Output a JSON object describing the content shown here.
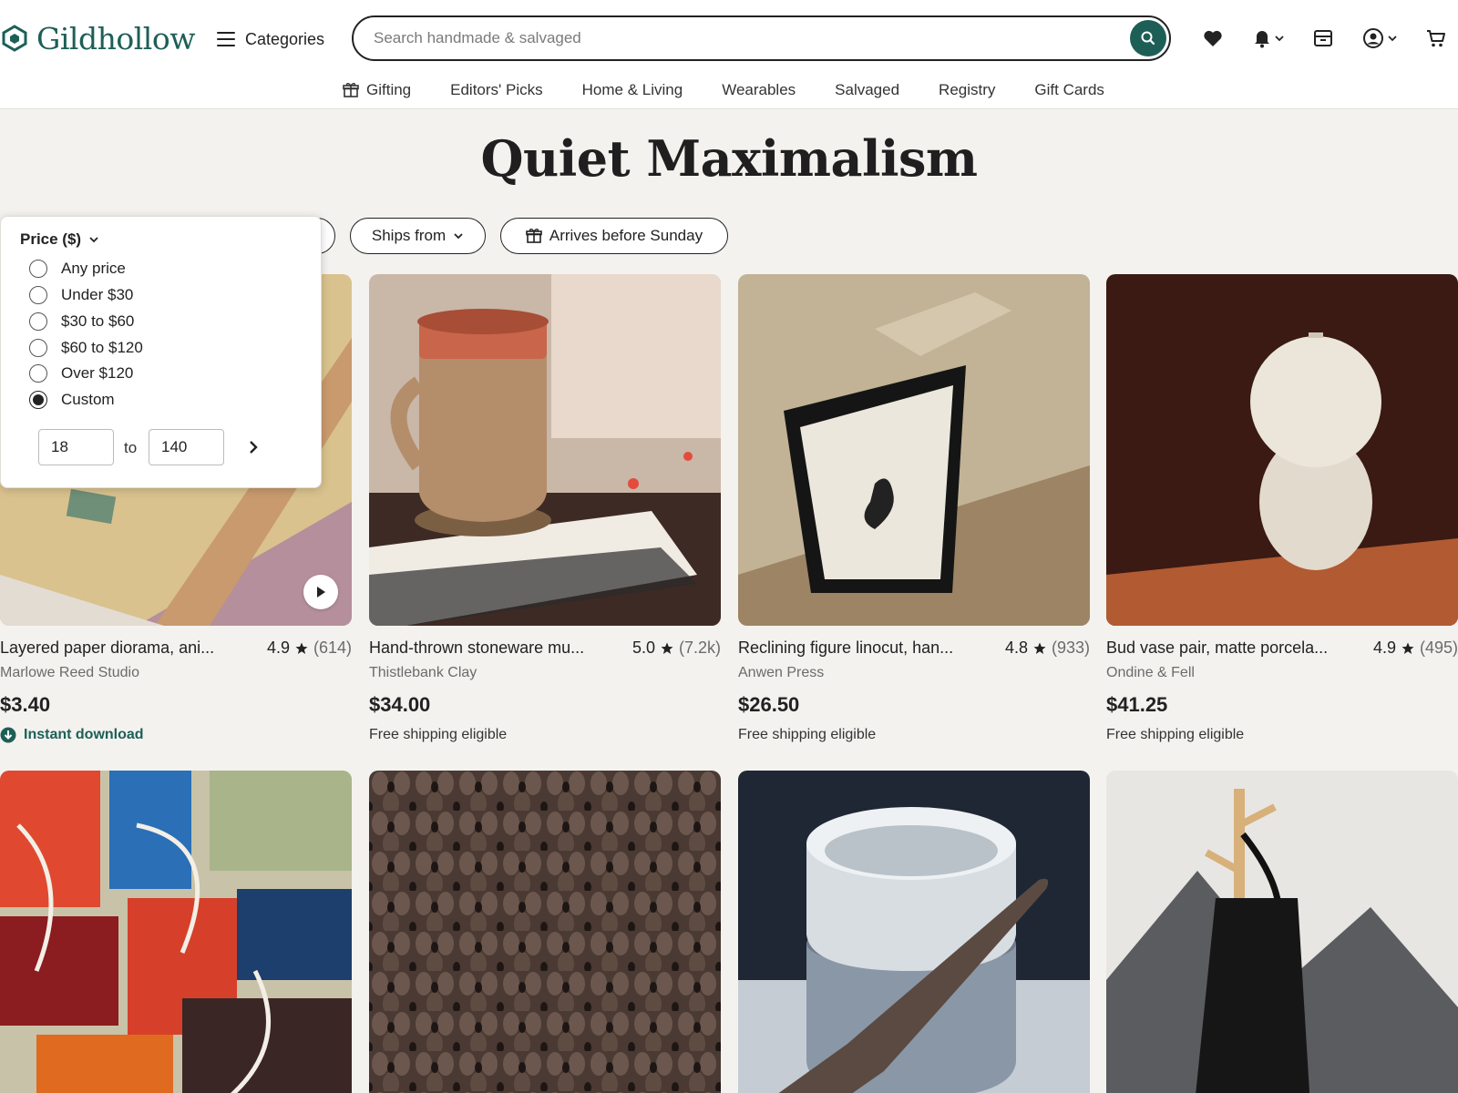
{
  "brand": {
    "name": "Gildhollow",
    "accent": "#1d5f57"
  },
  "header": {
    "categories_label": "Categories",
    "search_placeholder": "Search handmade & salvaged",
    "icons": [
      "heart-icon",
      "bell-icon",
      "shop-icon",
      "account-icon",
      "cart-icon"
    ]
  },
  "subnav": {
    "items": [
      {
        "label": "Gifting",
        "icon": "gift-icon"
      },
      {
        "label": "Editors' Picks"
      },
      {
        "label": "Home & Living"
      },
      {
        "label": "Wearables"
      },
      {
        "label": "Salvaged"
      },
      {
        "label": "Registry"
      },
      {
        "label": "Gift Cards"
      }
    ]
  },
  "page_title": "Quiet Maximalism",
  "filters": {
    "ships_from": "Ships from",
    "arrives": "Arrives before Sunday"
  },
  "price_filter": {
    "heading": "Price ($)",
    "options": [
      "Any price",
      "Under $30",
      "$30 to $60",
      "$60 to $120",
      "Over $120",
      "Custom"
    ],
    "selected": "Custom",
    "min": "18",
    "max": "140",
    "to_label": "to"
  },
  "products": [
    {
      "title": "Layered paper diorama, ani...",
      "rating": "4.9",
      "count": "(614)",
      "shop": "Marlowe Reed Studio",
      "price": "$3.40",
      "note": "Instant download",
      "has_video": true
    },
    {
      "title": "Hand-thrown stoneware mu...",
      "rating": "5.0",
      "count": "(7.2k)",
      "shop": "Thistlebank Clay",
      "price": "$34.00",
      "note": "Free shipping eligible"
    },
    {
      "title": "Reclining figure linocut, han...",
      "rating": "4.8",
      "count": "(933)",
      "shop": "Anwen Press",
      "price": "$26.50",
      "note": "Free shipping eligible"
    },
    {
      "title": "Bud vase pair, matte porcela...",
      "rating": "4.9",
      "count": "(495)",
      "shop": "Ondine & Fell",
      "price": "$41.25",
      "note": "Free shipping eligible"
    }
  ]
}
